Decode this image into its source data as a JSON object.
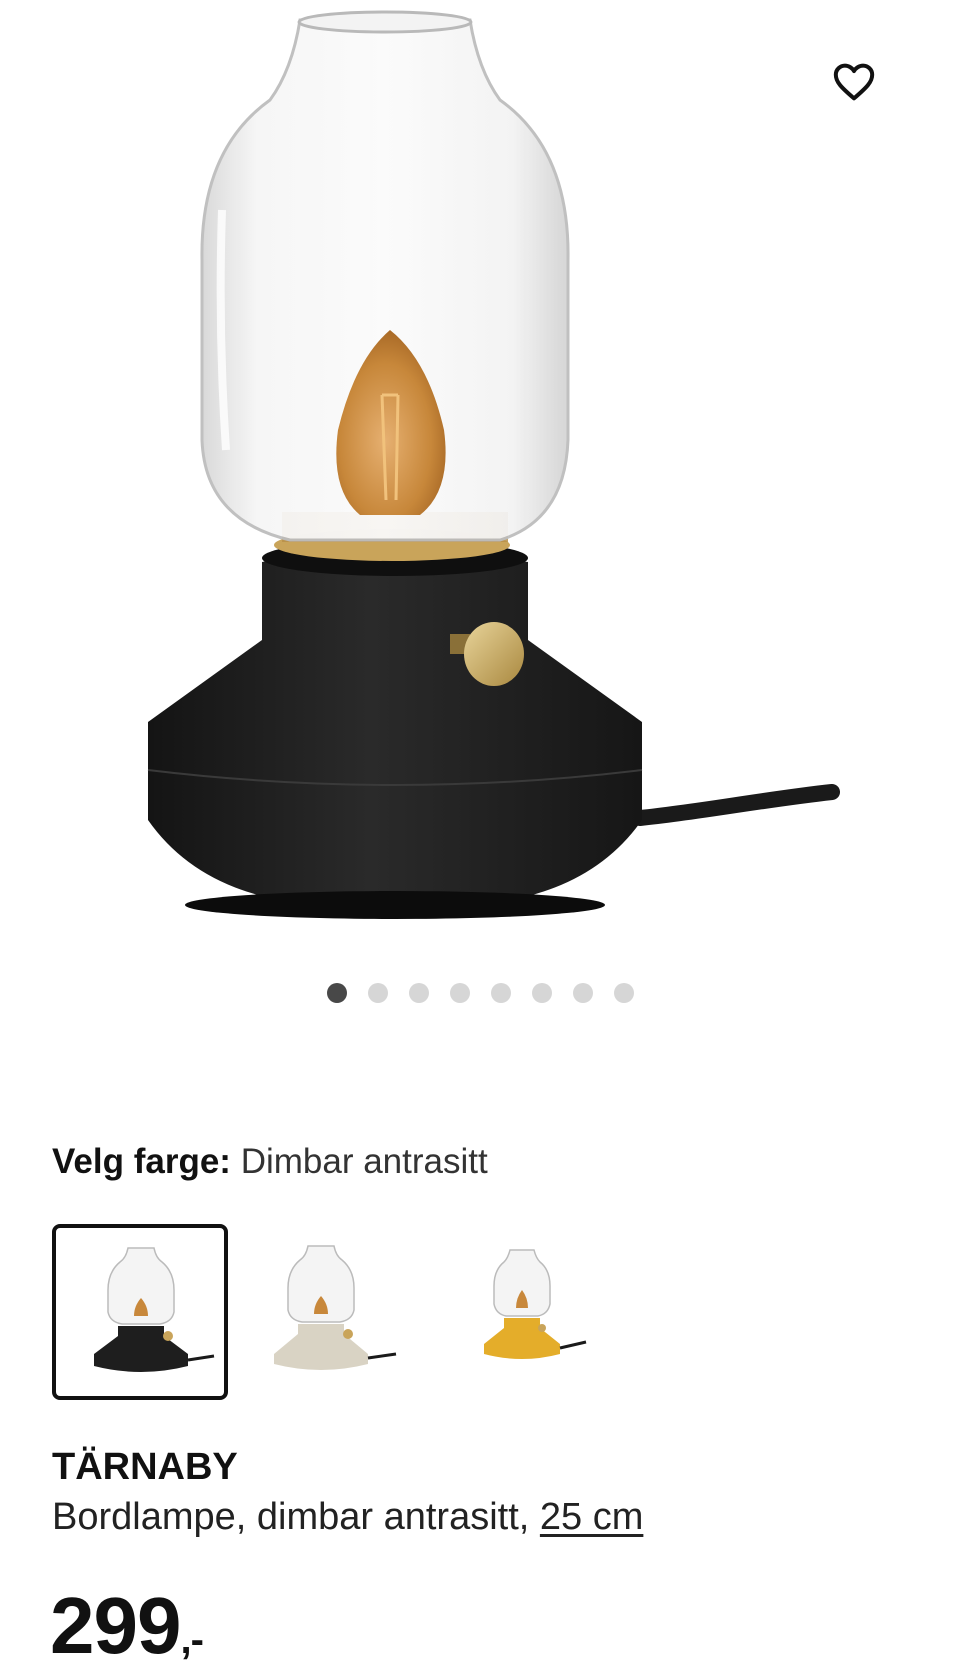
{
  "product": {
    "name": "TÄRNABY",
    "description": "Bordlampe, dimbar antrasitt, ",
    "size_link": "25 cm",
    "price_main": "299",
    "price_suffix": ",-"
  },
  "gallery": {
    "dot_count": 8,
    "active_index": 0
  },
  "color_selector": {
    "label": "Velg farge:",
    "selected_value": "Dimbar antrasitt",
    "options": [
      {
        "color": "#1e1e1e",
        "selected": true
      },
      {
        "color": "#d9d3c4",
        "selected": false
      },
      {
        "color": "#e4ad2a",
        "selected": false
      }
    ]
  },
  "icons": {
    "favorite": "heart-icon"
  },
  "colors": {
    "lamp_base": "#1b1b1b",
    "brass": "#c9a45a",
    "bulb": "#c8883b",
    "dot_active": "#484848",
    "dot_inactive": "#d6d6d6"
  }
}
